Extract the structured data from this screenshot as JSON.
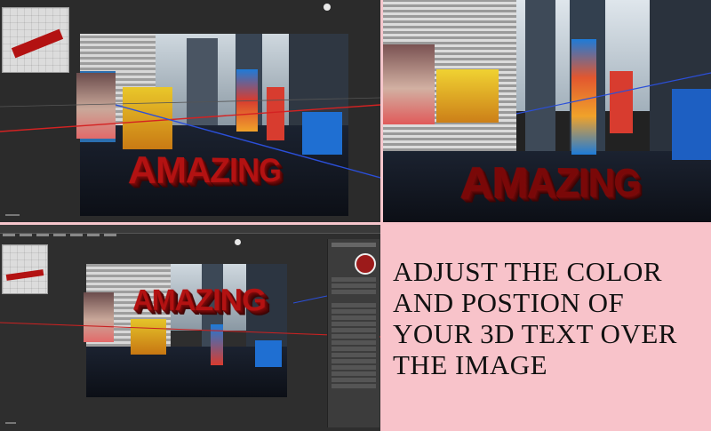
{
  "headline": {
    "line1": "ADJUST THE COLOR",
    "line2": "AND POSTION OF",
    "line3": "YOUR 3D TEXT OVER",
    "line4": "THE IMAGE"
  },
  "text_3d": "AMAZING",
  "colors": {
    "text3d": "#b31212",
    "background_pink": "#f8c3ca",
    "workspace": "#2b2b2b"
  },
  "icons": {
    "tl_badge": "circle-icon",
    "bl_badge": "circle-icon",
    "color_swatch": "color-swatch-icon"
  }
}
